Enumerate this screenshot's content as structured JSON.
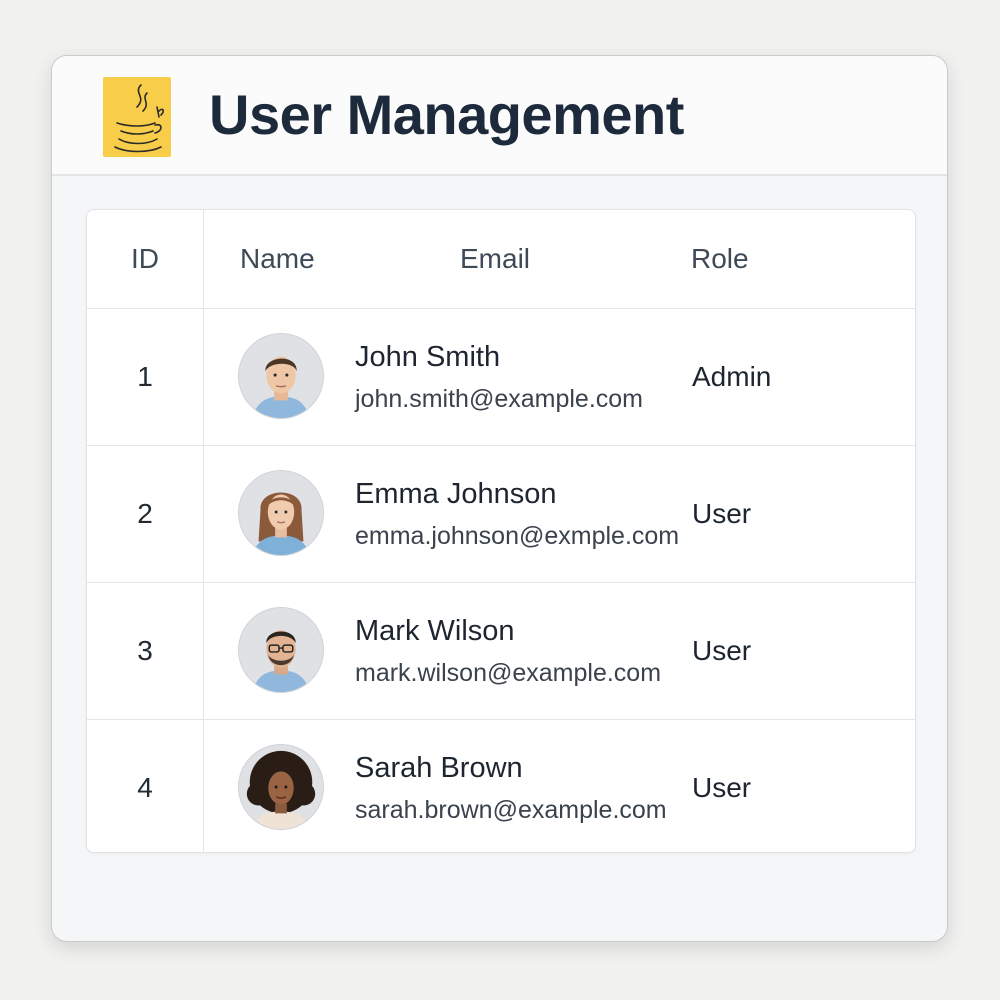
{
  "header": {
    "title": "User Management",
    "logo_icon": "java-coffee-cup-icon",
    "logo_color": "#f8cd4a"
  },
  "table": {
    "columns": [
      "ID",
      "Name",
      "Email",
      "Role"
    ],
    "rows": [
      {
        "id": "1",
        "name": "John Smith",
        "email": "john.smith@example.com",
        "role": "Admin",
        "avatar": "male-short-hair"
      },
      {
        "id": "2",
        "name": "Emma Johnson",
        "email": "emma.johnson@exmple.com",
        "role": "User",
        "avatar": "female-long-hair"
      },
      {
        "id": "3",
        "name": "Mark Wilson",
        "email": "mark.wilson@example.com",
        "role": "User",
        "avatar": "male-glasses-beard"
      },
      {
        "id": "4",
        "name": "Sarah Brown",
        "email": "sarah.brown@example.com",
        "role": "User",
        "avatar": "female-curly-hair"
      }
    ]
  },
  "colors": {
    "title_text": "#1c2a3c",
    "window_bg": "#f5f6f8",
    "border": "#e3e5e8"
  }
}
